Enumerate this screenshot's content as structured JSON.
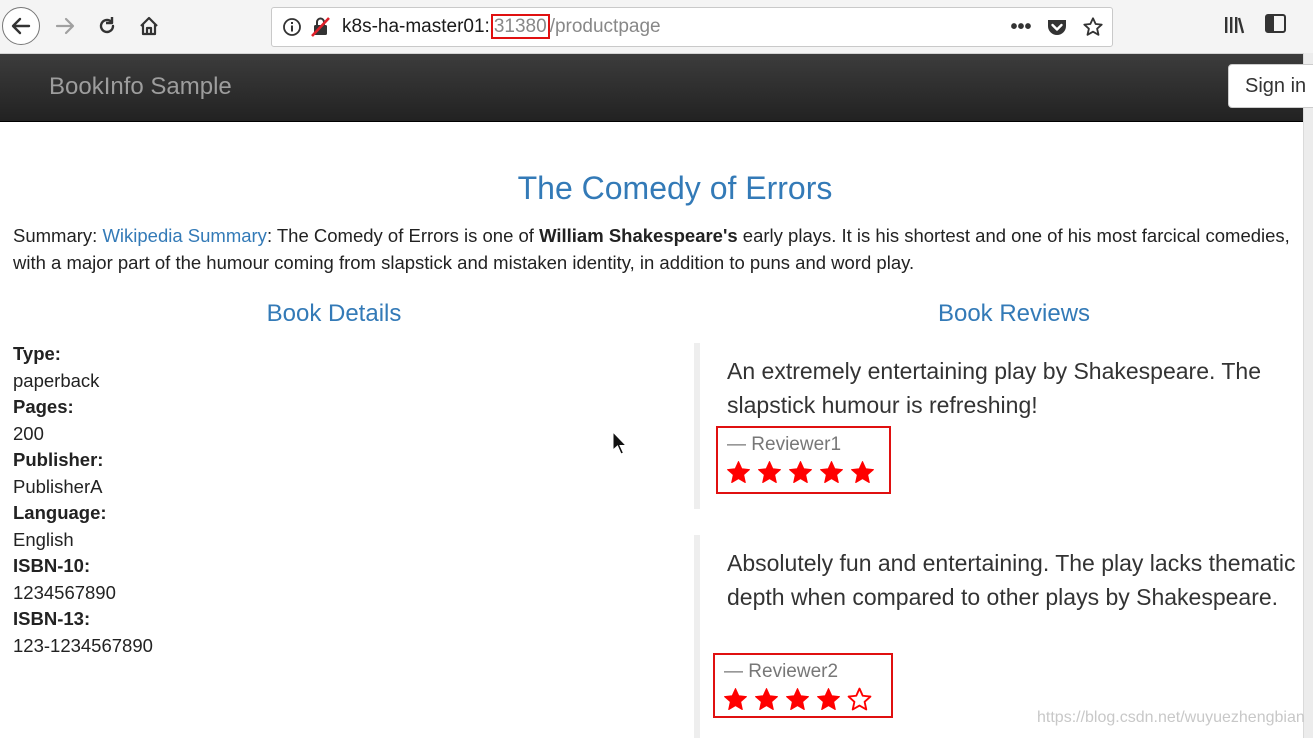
{
  "browser": {
    "url_host": "k8s-ha-master01:",
    "url_port": "31380",
    "url_path": "/productpage",
    "more_label": "•••"
  },
  "navbar": {
    "brand": "BookInfo Sample",
    "signin_label": "Sign in"
  },
  "page": {
    "title": "The Comedy of Errors",
    "summary": {
      "label": "Summary: ",
      "link": "Wikipedia Summary",
      "text_before_bold": ": The Comedy of Errors is one of ",
      "bold": "William Shakespeare's",
      "text_after_bold": " early plays. It is his shortest and one of his most farcical comedies,",
      "line2": "with a major part of the humour coming from slapstick and mistaken identity, in addition to puns and word play."
    }
  },
  "details": {
    "heading": "Book Details",
    "fields": [
      {
        "label": "Type:",
        "value": "paperback"
      },
      {
        "label": "Pages:",
        "value": "200"
      },
      {
        "label": "Publisher:",
        "value": "PublisherA"
      },
      {
        "label": "Language:",
        "value": "English"
      },
      {
        "label": "ISBN-10:",
        "value": "1234567890"
      },
      {
        "label": "ISBN-13:",
        "value": "123-1234567890"
      }
    ]
  },
  "reviews": {
    "heading": "Book Reviews",
    "items": [
      {
        "text": "An extremely entertaining play by Shakespeare. The slapstick humour is refreshing!",
        "reviewer": "— Reviewer1",
        "rating": 5,
        "max_rating": 5
      },
      {
        "text": "Absolutely fun and entertaining. The play lacks thematic depth when compared to other plays by Shakespeare.",
        "reviewer": "— Reviewer2",
        "rating": 4,
        "max_rating": 5
      }
    ],
    "star_color": "#ff0000"
  },
  "watermark": "https://blog.csdn.net/wuyuezhengbian",
  "colors": {
    "link": "#337ab7",
    "navbar": "#222222",
    "highlight_box": "#e01010"
  }
}
